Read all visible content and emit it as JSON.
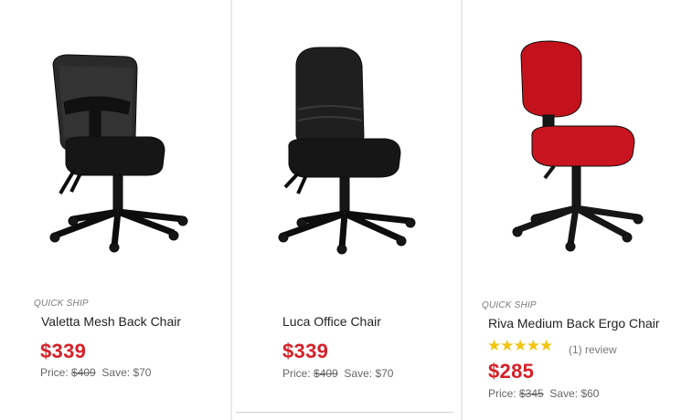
{
  "products": [
    {
      "quick_ship": "QUICK SHIP",
      "name": "Valetta Mesh Back Chair",
      "price": "$339",
      "price_label": "Price:",
      "was_price": "$409",
      "save_label": "Save:",
      "save_amount": "$70",
      "image": "black-mesh-office-chair"
    },
    {
      "quick_ship": "",
      "name": "Luca Office Chair",
      "price": "$339",
      "price_label": "Price:",
      "was_price": "$409",
      "save_label": "Save:",
      "save_amount": "$70",
      "image": "black-fabric-office-chair"
    },
    {
      "quick_ship": "QUICK SHIP",
      "name": "Riva Medium Back Ergo Chair",
      "price": "$285",
      "price_label": "Price:",
      "was_price": "$345",
      "save_label": "Save:",
      "save_amount": "$60",
      "rating": 5,
      "stars": "★★★★★",
      "review_text": "(1) review",
      "image": "red-fabric-ergo-chair"
    }
  ],
  "colors": {
    "price": "#d62027",
    "stars": "#f2c40f",
    "background": "#ececec"
  }
}
